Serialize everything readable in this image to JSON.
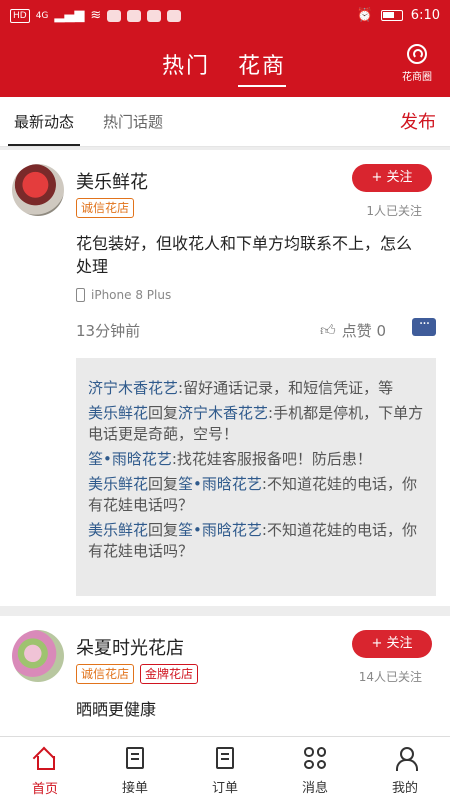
{
  "status_bar": {
    "left_chip": "HD",
    "signal": "4G",
    "time": "6:10",
    "icons": [
      "signal-icon",
      "wifi-icon",
      "app-notification-icons",
      "alarm-icon",
      "battery-icon"
    ]
  },
  "header": {
    "tabs": [
      "热门",
      "花商"
    ],
    "active_tab": "花商",
    "circle_button_label": "花商圈"
  },
  "sub_tabs": {
    "items": [
      "最新动态",
      "热门话题"
    ],
    "active": "最新动态",
    "publish_label": "发布"
  },
  "posts": [
    {
      "shop_name": "美乐鲜花",
      "tags": [
        "诚信花店"
      ],
      "follow_label": "+ 关注",
      "followers": "1人已关注",
      "text": "花包装好，但收花人和下单方均联系不上，怎么处理",
      "device": "iPhone 8 Plus",
      "time": "13分钟前",
      "like_label": "点赞 0",
      "comments": [
        {
          "user": "济宁木香花艺",
          "reply_word": "",
          "reply_to": "",
          "text": ":留好通话记录，和短信凭证，等"
        },
        {
          "user": "美乐鲜花",
          "reply_word": "回复",
          "reply_to": "济宁木香花艺",
          "text": ":手机都是停机，下单方电话更是奇葩，空号！"
        },
        {
          "user": "筌•雨晗花艺",
          "reply_word": "",
          "reply_to": "",
          "text": ":找花娃客服报备吧！防后患！"
        },
        {
          "user": "美乐鲜花",
          "reply_word": "回复",
          "reply_to": "筌•雨晗花艺",
          "text": ":不知道花娃的电话，你有花娃电话吗？"
        },
        {
          "user": "美乐鲜花",
          "reply_word": "回复",
          "reply_to": "筌•雨晗花艺",
          "text": ":不知道花娃的电话，你有花娃电话吗？"
        }
      ]
    },
    {
      "shop_name": "朵夏时光花店",
      "tags": [
        "诚信花店",
        "金牌花店"
      ],
      "follow_label": "+ 关注",
      "followers": "14人已关注",
      "text": "晒晒更健康"
    }
  ],
  "tab_bar": [
    {
      "label": "首页",
      "icon": "home-icon",
      "active": true
    },
    {
      "label": "接单",
      "icon": "receive-order-icon",
      "active": false
    },
    {
      "label": "订单",
      "icon": "order-list-icon",
      "active": false
    },
    {
      "label": "消息",
      "icon": "message-grid-icon",
      "active": false
    },
    {
      "label": "我的",
      "icon": "profile-icon",
      "active": false
    }
  ],
  "colors": {
    "brand_red": "#d0141f",
    "link_blue": "#2f5a8c",
    "tag_orange": "#e1731b"
  }
}
